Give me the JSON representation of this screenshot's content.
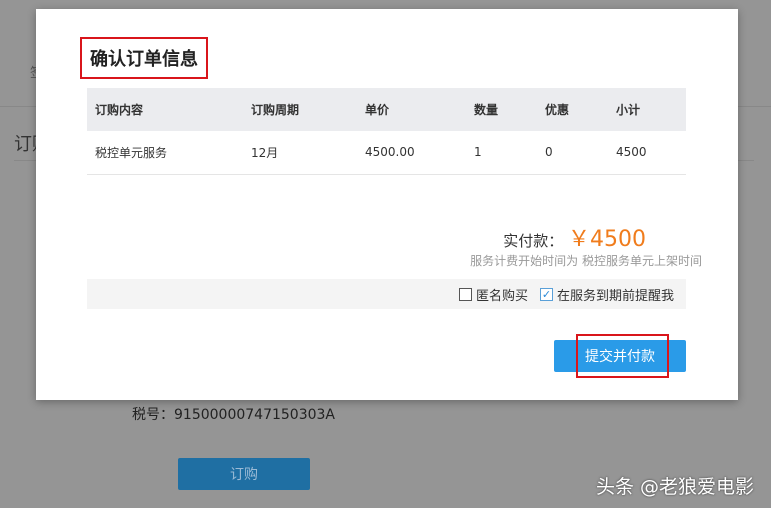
{
  "background": {
    "tab_label": "签",
    "section_title": "订购",
    "tax_id": "税号：91500000747150303A",
    "order_button": "订购"
  },
  "watermark": "头条 @老狼爱电影",
  "modal": {
    "title": "确认订单信息",
    "table": {
      "headers": [
        "订购内容",
        "订购周期",
        "单价",
        "数量",
        "优惠",
        "小计"
      ],
      "rows": [
        [
          "税控单元服务",
          "12月",
          "4500.00",
          "1",
          "0",
          "4500"
        ]
      ]
    },
    "total_label": "实付款：",
    "total_amount": "￥4500",
    "note": "服务计费开始时间为 税控服务单元上架时间",
    "options": [
      {
        "label": "匿名购买",
        "checked": false
      },
      {
        "label": "在服务到期前提醒我",
        "checked": true
      }
    ],
    "submit_label": "提交并付款",
    "colors": {
      "accent": "#2a9be8",
      "price": "#f07c1c",
      "highlight": "#d9151b"
    }
  }
}
